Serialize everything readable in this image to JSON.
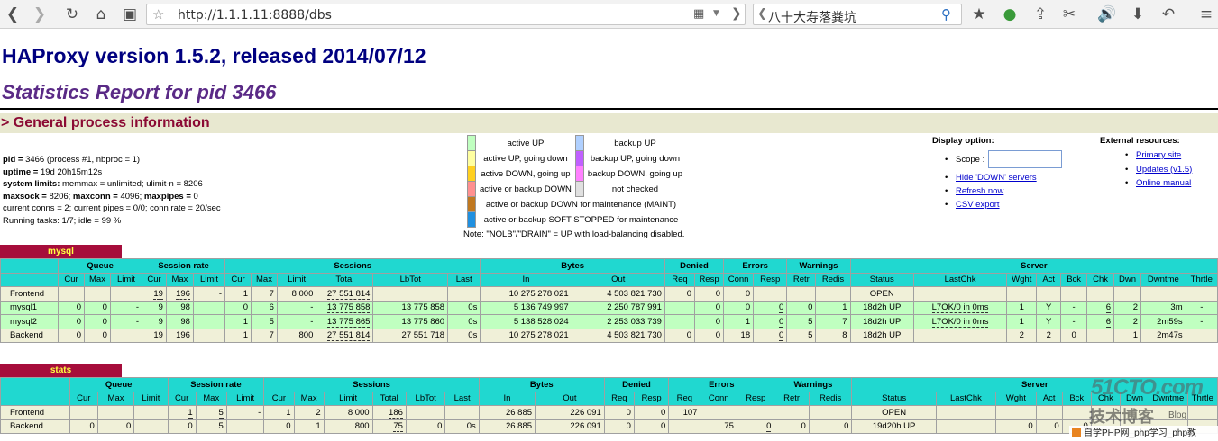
{
  "browser": {
    "url": "http://1.1.1.11:8888/dbs",
    "search_value": "八十大寿落粪坑"
  },
  "page": {
    "title": "HAProxy version 1.5.2, released 2014/07/12",
    "subtitle": "Statistics Report for pid 3466",
    "section_header": "> General process information"
  },
  "process_info": {
    "l1_label": "pid = ",
    "l1_value": "3466 (process #1, nbproc = 1)",
    "l2_label": "uptime = ",
    "l2_value": "19d 20h15m12s",
    "l3_label": "system limits:",
    "l3_value": " memmax = unlimited; ulimit-n = 8206",
    "l4_label1": "maxsock = ",
    "l4_value1": "8206; ",
    "l4_label2": "maxconn = ",
    "l4_value2": "4096; ",
    "l4_label3": "maxpipes = ",
    "l4_value3": "0",
    "l5": "current conns = 2; current pipes = 0/0; conn rate = 20/sec",
    "l6": "Running tasks: 1/7; idle = 99 %"
  },
  "legend": {
    "items": [
      {
        "left": "active UP",
        "left_color": "#c0ffc0",
        "right": "backup UP",
        "right_color": "#b0d0ff"
      },
      {
        "left": "active UP, going down",
        "left_color": "#ffffa0",
        "right": "backup UP, going down",
        "right_color": "#c060ff"
      },
      {
        "left": "active DOWN, going up",
        "left_color": "#ffd020",
        "right": "backup DOWN, going up",
        "right_color": "#ff80ff"
      },
      {
        "left": "active or backup DOWN",
        "left_color": "#ff9090",
        "right": "not checked",
        "right_color": "#e0e0e0"
      },
      {
        "left": "active or backup DOWN for maintenance (MAINT)",
        "left_color": "#c07820"
      },
      {
        "left": "active or backup SOFT STOPPED for maintenance",
        "left_color": "#2090e0"
      }
    ],
    "note": "Note: \"NOLB\"/\"DRAIN\" = UP with load-balancing disabled."
  },
  "display_options": {
    "title": "Display option:",
    "scope_label": "Scope :",
    "scope_value": "",
    "hide_down": "Hide 'DOWN' servers",
    "refresh": "Refresh now",
    "csv": "CSV export"
  },
  "external": {
    "title": "External resources:",
    "primary": "Primary site",
    "updates": "Updates (v1.5)",
    "manual": "Online manual"
  },
  "headers": {
    "queue": "Queue",
    "session_rate": "Session rate",
    "sessions": "Sessions",
    "bytes": "Bytes",
    "denied": "Denied",
    "errors": "Errors",
    "warnings": "Warnings",
    "server": "Server",
    "cur": "Cur",
    "max": "Max",
    "limit": "Limit",
    "total": "Total",
    "lbtot": "LbTot",
    "last": "Last",
    "in": "In",
    "out": "Out",
    "req": "Req",
    "resp": "Resp",
    "conn": "Conn",
    "retr": "Retr",
    "redis": "Redis",
    "status": "Status",
    "lastchk": "LastChk",
    "wght": "Wght",
    "act": "Act",
    "bck": "Bck",
    "chk": "Chk",
    "dwn": "Dwn",
    "dwntme": "Dwntme",
    "thrtle": "Thrtle"
  },
  "mysql": {
    "name": "mysql",
    "frontend": {
      "name": "Frontend",
      "rate_cur": "19",
      "rate_max": "196",
      "rate_lim": "-",
      "s_cur": "1",
      "s_max": "7",
      "s_lim": "8 000",
      "s_tot": "27 551 814",
      "in": "10 275 278 021",
      "out": "4 503 821 730",
      "d_req": "0",
      "d_resp": "0",
      "e_req": "0",
      "status": "OPEN"
    },
    "servers": [
      {
        "name": "mysql1",
        "q_cur": "0",
        "q_max": "0",
        "q_lim": "-",
        "r_cur": "9",
        "r_max": "98",
        "s_cur": "0",
        "s_max": "6",
        "s_lim": "-",
        "s_tot": "13 775 858",
        "lbtot": "13 775 858",
        "last": "0s",
        "in": "5 136 749 997",
        "out": "2 250 787 991",
        "d_resp": "0",
        "e_conn": "0",
        "e_resp": "0",
        "retr": "0",
        "redis": "1",
        "status": "18d2h UP",
        "lastchk": "L7OK/0 in 0ms",
        "wght": "1",
        "act": "Y",
        "bck": "-",
        "chk": "6",
        "dwn": "2",
        "dwntme": "3m",
        "thrtle": "-"
      },
      {
        "name": "mysql2",
        "q_cur": "0",
        "q_max": "0",
        "q_lim": "-",
        "r_cur": "9",
        "r_max": "98",
        "s_cur": "1",
        "s_max": "5",
        "s_lim": "-",
        "s_tot": "13 775 865",
        "lbtot": "13 775 860",
        "last": "0s",
        "in": "5 138 528 024",
        "out": "2 253 033 739",
        "d_resp": "0",
        "e_conn": "1",
        "e_resp": "0",
        "retr": "5",
        "redis": "7",
        "status": "18d2h UP",
        "lastchk": "L7OK/0 in 0ms",
        "wght": "1",
        "act": "Y",
        "bck": "-",
        "chk": "6",
        "dwn": "2",
        "dwntme": "2m59s",
        "thrtle": "-"
      }
    ],
    "backend": {
      "name": "Backend",
      "q_cur": "0",
      "q_max": "0",
      "r_cur": "19",
      "r_max": "196",
      "s_cur": "1",
      "s_max": "7",
      "s_lim": "800",
      "s_tot": "27 551 814",
      "lbtot": "27 551 718",
      "last": "0s",
      "in": "10 275 278 021",
      "out": "4 503 821 730",
      "d_req": "0",
      "d_resp": "0",
      "e_conn": "18",
      "e_resp": "0",
      "retr": "5",
      "redis": "8",
      "status": "18d2h UP",
      "wght": "2",
      "act": "2",
      "bck": "0",
      "dwn": "1",
      "dwntme": "2m47s"
    }
  },
  "stats": {
    "name": "stats",
    "frontend": {
      "name": "Frontend",
      "r_cur": "1",
      "r_max": "5",
      "r_lim": "-",
      "s_cur": "1",
      "s_max": "2",
      "s_lim": "8 000",
      "s_tot": "186",
      "in": "26 885",
      "out": "226 091",
      "d_req": "0",
      "d_resp": "0",
      "e_req": "107",
      "status": "OPEN"
    },
    "backend": {
      "name": "Backend",
      "q_cur": "0",
      "q_max": "0",
      "r_cur": "0",
      "r_max": "5",
      "s_cur": "0",
      "s_max": "1",
      "s_lim": "800",
      "s_tot": "75",
      "lbtot": "0",
      "last": "0s",
      "in": "26 885",
      "out": "226 091",
      "d_req": "0",
      "d_resp": "0",
      "e_conn": "75",
      "e_resp": "0",
      "retr": "0",
      "redis": "0",
      "status": "19d20h UP",
      "wght": "0",
      "act": "0",
      "bck": "0"
    }
  },
  "watermark": {
    "site": "51CTO.com",
    "brand": "技术博客",
    "blog": "Blog",
    "tagline": "自学PHP网_php学习_php教"
  }
}
